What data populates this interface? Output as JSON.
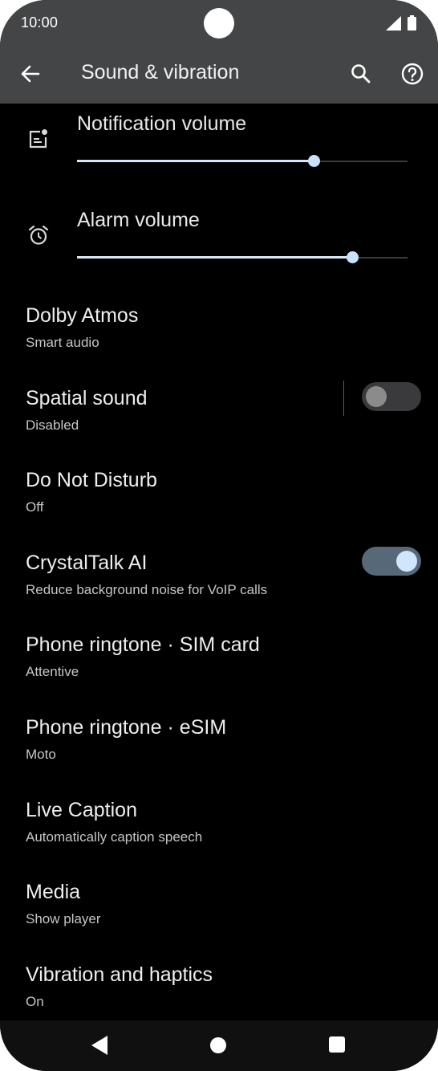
{
  "status": {
    "time": "10:00"
  },
  "appbar": {
    "title": "Sound & vibration"
  },
  "volumes": [
    {
      "label": "Notification volume",
      "level": 0.717
    },
    {
      "label": "Alarm volume",
      "level": 0.833
    }
  ],
  "items": [
    {
      "title": "Dolby Atmos",
      "subtitle": "Smart audio"
    },
    {
      "title": "Spatial sound",
      "subtitle": "Disabled",
      "toggle": "off"
    },
    {
      "title": "Do Not Disturb",
      "subtitle": "Off"
    },
    {
      "title": "CrystalTalk AI",
      "subtitle": "Reduce background noise for VoIP calls",
      "toggle": "on"
    },
    {
      "title": "Phone ringtone · SIM card",
      "subtitle": "Attentive"
    },
    {
      "title": "Phone ringtone · eSIM",
      "subtitle": "Moto"
    },
    {
      "title": "Live Caption",
      "subtitle": "Automatically caption speech"
    },
    {
      "title": "Media",
      "subtitle": "Show player"
    },
    {
      "title": "Vibration and haptics",
      "subtitle": "On"
    }
  ],
  "icons": {
    "back": "arrow-left-icon",
    "search": "search-icon",
    "help": "help-circle-icon",
    "notification": "notification-icon",
    "alarm": "alarm-clock-icon"
  },
  "colors": {
    "appbar": "#444546",
    "background": "#000000",
    "accent": "#c8e2fb",
    "switch_on_track": "#576878"
  }
}
